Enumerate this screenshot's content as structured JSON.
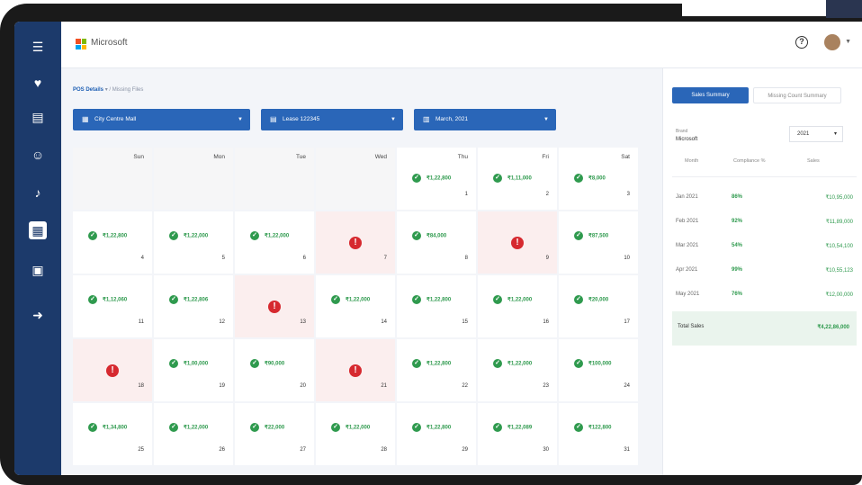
{
  "topbar": {
    "brand": "Microsoft",
    "help_icon": "?"
  },
  "colors": {
    "primary": "#2a66b8",
    "sidebar": "#1c3a6b",
    "success": "#2f9a4e",
    "error": "#d6292f"
  },
  "breadcrumb": {
    "parent": "POS Details",
    "current": "Missing Files"
  },
  "filters": {
    "mall": "City Centre Mall",
    "lease": "Lease 122345",
    "month": "March, 2021"
  },
  "sidebar_icons": [
    "menu-icon",
    "handshake-icon",
    "buildings-icon",
    "user-icon",
    "bell-icon",
    "document-icon",
    "clipboard-icon",
    "exit-icon"
  ],
  "calendar": {
    "weekdays": [
      "Sun",
      "Mon",
      "Tue",
      "Wed",
      "Thu",
      "Fri",
      "Sat"
    ],
    "weeks": [
      [
        {
          "day": "",
          "status": "empty"
        },
        {
          "day": "",
          "status": "empty"
        },
        {
          "day": "",
          "status": "empty"
        },
        {
          "day": "",
          "status": "empty"
        },
        {
          "day": "1",
          "status": "ok",
          "amount": "₹1,22,800"
        },
        {
          "day": "2",
          "status": "ok",
          "amount": "₹1,11,000"
        },
        {
          "day": "3",
          "status": "ok",
          "amount": "₹8,000"
        }
      ],
      [
        {
          "day": "4",
          "status": "ok",
          "amount": "₹1,22,800"
        },
        {
          "day": "5",
          "status": "ok",
          "amount": "₹1,22,000"
        },
        {
          "day": "6",
          "status": "ok",
          "amount": "₹1,22,000"
        },
        {
          "day": "7",
          "status": "missing"
        },
        {
          "day": "8",
          "status": "ok",
          "amount": "₹84,000"
        },
        {
          "day": "9",
          "status": "missing"
        },
        {
          "day": "10",
          "status": "ok",
          "amount": "₹87,500"
        }
      ],
      [
        {
          "day": "11",
          "status": "ok",
          "amount": "₹1,12,060"
        },
        {
          "day": "12",
          "status": "ok",
          "amount": "₹1,22,806"
        },
        {
          "day": "13",
          "status": "missing"
        },
        {
          "day": "14",
          "status": "ok",
          "amount": "₹1,22,000"
        },
        {
          "day": "15",
          "status": "ok",
          "amount": "₹1,22,800"
        },
        {
          "day": "16",
          "status": "ok",
          "amount": "₹1,22,000"
        },
        {
          "day": "17",
          "status": "ok",
          "amount": "₹20,000"
        }
      ],
      [
        {
          "day": "18",
          "status": "missing"
        },
        {
          "day": "19",
          "status": "ok",
          "amount": "₹1,00,000"
        },
        {
          "day": "20",
          "status": "ok",
          "amount": "₹90,000"
        },
        {
          "day": "21",
          "status": "missing"
        },
        {
          "day": "22",
          "status": "ok",
          "amount": "₹1,22,800"
        },
        {
          "day": "23",
          "status": "ok",
          "amount": "₹1,22,000"
        },
        {
          "day": "24",
          "status": "ok",
          "amount": "₹100,000"
        }
      ],
      [
        {
          "day": "25",
          "status": "ok",
          "amount": "₹1,34,800"
        },
        {
          "day": "26",
          "status": "ok",
          "amount": "₹1,22,000"
        },
        {
          "day": "27",
          "status": "ok",
          "amount": "₹22,000"
        },
        {
          "day": "28",
          "status": "ok",
          "amount": "₹1,22,000"
        },
        {
          "day": "29",
          "status": "ok",
          "amount": "₹1,22,800"
        },
        {
          "day": "30",
          "status": "ok",
          "amount": "₹1,22,089"
        },
        {
          "day": "31",
          "status": "ok",
          "amount": "₹122,800"
        }
      ]
    ]
  },
  "summary": {
    "tabs": [
      "Sales Summary",
      "Missing Count Summary"
    ],
    "brand_label": "Brand",
    "brand_value": "Microsoft",
    "year": "2021",
    "columns": [
      "Month",
      "Compliance %",
      "Sales"
    ],
    "rows": [
      {
        "month": "Jan 2021",
        "compliance": "86%",
        "sales": "₹10,95,000"
      },
      {
        "month": "Feb 2021",
        "compliance": "92%",
        "sales": "₹11,89,000"
      },
      {
        "month": "Mar 2021",
        "compliance": "54%",
        "sales": "₹10,54,100"
      },
      {
        "month": "Apr 2021",
        "compliance": "99%",
        "sales": "₹10,55,123"
      },
      {
        "month": "May 2021",
        "compliance": "76%",
        "sales": "₹12,00,000"
      }
    ],
    "total_label": "Total Sales",
    "total_value": "₹4,22,86,000"
  }
}
